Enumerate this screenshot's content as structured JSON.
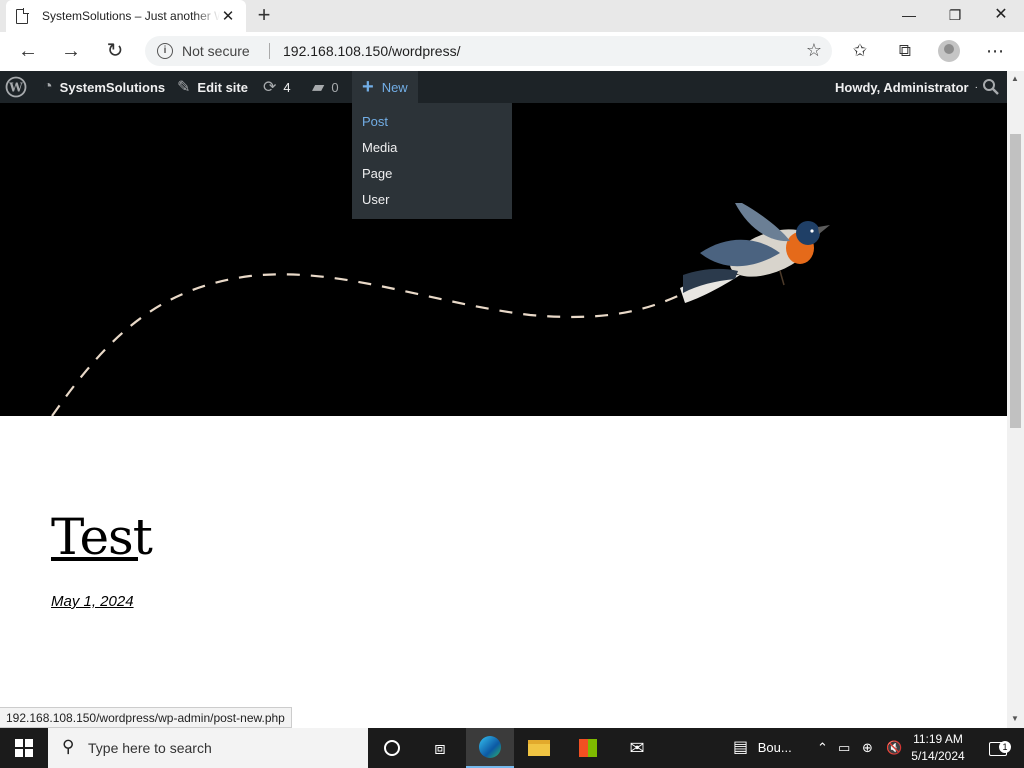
{
  "browser": {
    "tab_title": "SystemSolutions – Just another WordPress site",
    "tab_close": "✕",
    "new_tab": "+",
    "win_minimize": "—",
    "win_restore": "❐",
    "win_close": "✕",
    "back": "←",
    "forward": "→",
    "refresh": "↻",
    "security_label": "Not secure",
    "url": "192.168.108.150/wordpress/",
    "status_url": "192.168.108.150/wordpress/wp-admin/post-new.php"
  },
  "adminbar": {
    "site_name": "SystemSolutions",
    "edit_site": "Edit site",
    "updates_count": "4",
    "comments_count": "0",
    "new_label": "New",
    "howdy": "Howdy, Administrator",
    "new_menu": [
      "Post",
      "Media",
      "Page",
      "User"
    ]
  },
  "post": {
    "title": "Test",
    "date": "May 1, 2024"
  },
  "taskbar": {
    "search_placeholder": "Type here to search",
    "app_label": "Bou...",
    "time": "11:19 AM",
    "date": "5/14/2024",
    "notification_count": "1"
  },
  "colors": {
    "adminbar_bg": "#1d2327",
    "submenu_bg": "#2c3338",
    "wp_blue": "#72aee6",
    "hero_bg": "#000000"
  }
}
